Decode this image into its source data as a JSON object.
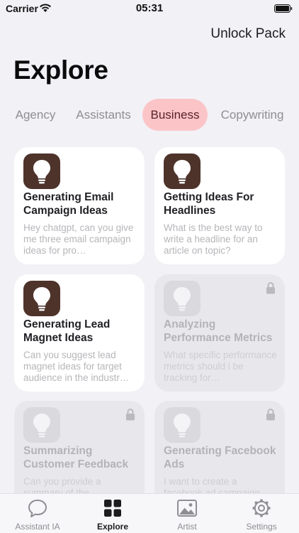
{
  "status_bar": {
    "carrier": "Carrier",
    "time": "05:31"
  },
  "header": {
    "unlock_label": "Unlock Pack",
    "title": "Explore"
  },
  "tabs": [
    {
      "label": "Agency"
    },
    {
      "label": "Assistants"
    },
    {
      "label": "Business",
      "active": true
    },
    {
      "label": "Copywriting"
    }
  ],
  "cards": [
    {
      "title": "Generating Email Campaign Ideas",
      "desc": "Hey chatgpt, can you give me three email campaign ideas for pro…",
      "locked": false
    },
    {
      "title": "Getting Ideas For Headlines",
      "desc": "What is the best way to write a headline for an article on topic?",
      "locked": false
    },
    {
      "title": "Generating Lead Magnet Ideas",
      "desc": "Can you suggest lead magnet ideas for target audience in the industr…",
      "locked": false
    },
    {
      "title": "Analyzing Performance Metrics",
      "desc": "What specific performance metrics should i be tracking for…",
      "locked": true
    },
    {
      "title": "Summarizing Customer Feedback",
      "desc": "Can you provide a summary of the…",
      "locked": true
    },
    {
      "title": "Generating Facebook Ads",
      "desc": "I want to create a facebook ad campaign…",
      "locked": true
    }
  ],
  "tabbar": [
    {
      "label": "Assistant IA",
      "icon": "chat-bubble-icon"
    },
    {
      "label": "Explore",
      "icon": "grid-icon",
      "active": true
    },
    {
      "label": "Artist",
      "icon": "photo-icon"
    },
    {
      "label": "Settings",
      "icon": "gear-icon"
    }
  ],
  "colors": {
    "background": "#f2f1f6",
    "active_tab_pill": "#fbc5c8",
    "icon_tile": "#4e332b",
    "locked_card": "#e8e8ec"
  }
}
